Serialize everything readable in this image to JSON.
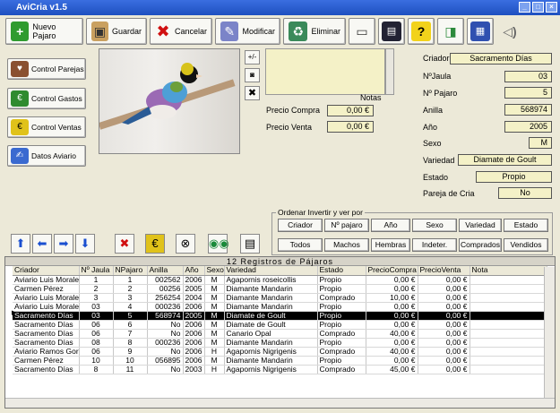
{
  "window": {
    "title": "AviCria v1.5"
  },
  "toolbar": {
    "nuevo": "Nuevo Pajaro",
    "guardar": "Guardar",
    "cancelar": "Cancelar",
    "modificar": "Modificar",
    "eliminar": "Eliminar"
  },
  "sidebar": {
    "parejas": "Control Parejas",
    "gastos": "Control Gastos",
    "ventas": "Control Ventas",
    "datos": "Datos Aviario"
  },
  "photo_buttons": {
    "plusminus": "+/-"
  },
  "notes_label": "Notas",
  "precio": {
    "compra_label": "Precio Compra",
    "compra_value": "0,00 €",
    "venta_label": "Precio Venta",
    "venta_value": "0,00 €"
  },
  "detail": {
    "criador_label": "Criador",
    "criador_value": "Sacramento Días",
    "jaula_label": "NºJaula",
    "jaula_value": "03",
    "pajaro_label": "Nº Pajaro",
    "pajaro_value": "5",
    "anilla_label": "Anilla",
    "anilla_value": "568974",
    "anio_label": "Año",
    "anio_value": "2005",
    "sexo_label": "Sexo",
    "sexo_value": "M",
    "variedad_label": "Variedad",
    "variedad_value": "Diamate de Goult",
    "estado_label": "Estado",
    "estado_value": "Propio",
    "pareja_label": "Pareja de Cria",
    "pareja_value": "No"
  },
  "ordenar": {
    "label": "Ordenar Invertir y ver por",
    "row1": [
      "Criador",
      "Nº pajaro",
      "Año",
      "Sexo",
      "Variedad",
      "Estado"
    ],
    "row2": [
      "Todos",
      "Machos",
      "Hembras",
      "Indeter.",
      "Comprados",
      "Vendidos"
    ]
  },
  "grid": {
    "title": "12 Registros de Pájaros",
    "columns": [
      "Criador",
      "Nº Jaula",
      "NPajaro",
      "Anilla",
      "Año",
      "Sexo",
      "Variedad",
      "Estado",
      "PrecioCompra",
      "PrecioVenta",
      "Nota"
    ],
    "selected_row": 4,
    "rows": [
      [
        "Aviario Luis Morale",
        "1",
        "1",
        "002562",
        "2006",
        "M",
        "Agapornis roseicollis",
        "Propio",
        "0,00 €",
        "0,00 €",
        ""
      ],
      [
        "Carmen Pérez",
        "2",
        "2",
        "00256",
        "2005",
        "M",
        "Diamante Mandarin",
        "Propio",
        "0,00 €",
        "0,00 €",
        ""
      ],
      [
        "Aviario Luis Morale",
        "3",
        "3",
        "256254",
        "2004",
        "M",
        "Diamante Mandarin",
        "Comprado",
        "10,00 €",
        "0,00 €",
        ""
      ],
      [
        "Aviario Luis Morale",
        "03",
        "4",
        "000236",
        "2006",
        "M",
        "Diamante Mandarin",
        "Propio",
        "0,00 €",
        "0,00 €",
        ""
      ],
      [
        "Sacramento Días",
        "03",
        "5",
        "568974",
        "2005",
        "M",
        "Diamate de Goult",
        "Propio",
        "0,00 €",
        "0,00 €",
        ""
      ],
      [
        "Sacramento Días",
        "06",
        "6",
        "No",
        "2006",
        "M",
        "Diamate de Goult",
        "Propio",
        "0,00 €",
        "0,00 €",
        ""
      ],
      [
        "Sacramento Días",
        "06",
        "7",
        "No",
        "2006",
        "M",
        "Canario Opal",
        "Comprado",
        "40,00 €",
        "0,00 €",
        ""
      ],
      [
        "Sacramento Días",
        "08",
        "8",
        "000236",
        "2006",
        "M",
        "Diamante Mandarin",
        "Propio",
        "0,00 €",
        "0,00 €",
        ""
      ],
      [
        "Aviario Ramos Gor",
        "06",
        "9",
        "No",
        "2006",
        "H",
        "Agapornis Nigrigenis",
        "Comprado",
        "40,00 €",
        "0,00 €",
        ""
      ],
      [
        "Carmen Pérez",
        "10",
        "10",
        "056895",
        "2006",
        "M",
        "Diamante Mandarin",
        "Propio",
        "0,00 €",
        "0,00 €",
        ""
      ],
      [
        "Sacramento Días",
        "8",
        "11",
        "No",
        "2003",
        "H",
        "Agapornis Nigrigenis",
        "Comprado",
        "45,00 €",
        "0,00 €",
        ""
      ]
    ]
  },
  "colors": {
    "titlebar": "#1e50c0",
    "field_bg": "#f4f1c7",
    "selected_row": "#000000"
  }
}
